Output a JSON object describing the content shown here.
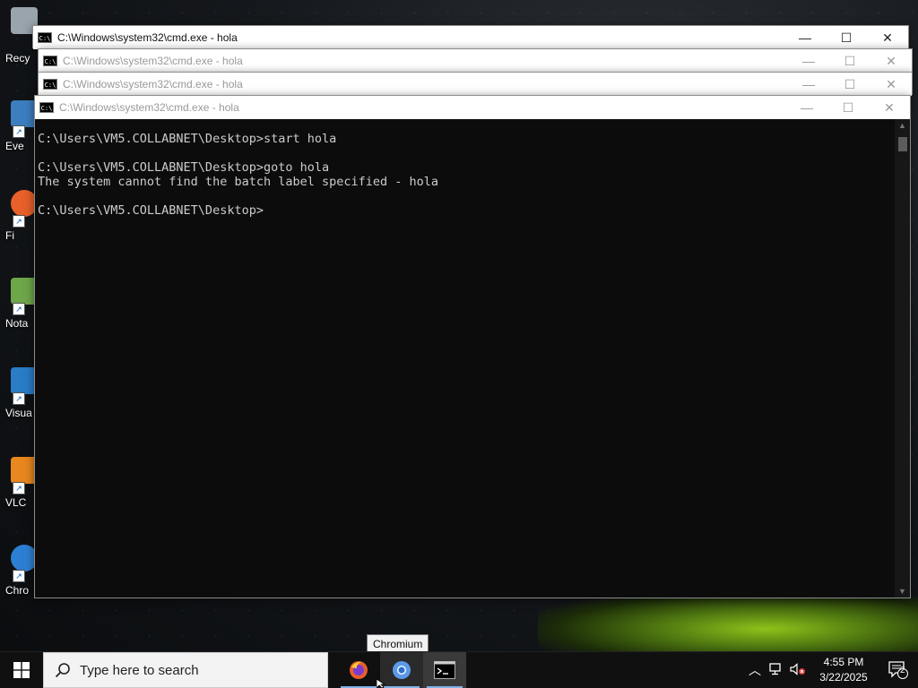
{
  "desktop": {
    "icons": [
      {
        "label": "Recy",
        "color": "#9aa4ad"
      },
      {
        "label": "Eve",
        "color": "#3c7ebf"
      },
      {
        "label": "Fi",
        "color": "#e8602a"
      },
      {
        "label": "Nota",
        "color": "#6ea64a"
      },
      {
        "label": "Visua",
        "color": "#2a7cc7"
      },
      {
        "label": "VLC",
        "color": "#e8871e"
      },
      {
        "label": "Chro",
        "color": "#2d7fd4"
      }
    ]
  },
  "windows": [
    {
      "title": "C:\\Windows\\system32\\cmd.exe - hola"
    },
    {
      "title": "C:\\Windows\\system32\\cmd.exe - hola"
    },
    {
      "title": "C:\\Windows\\system32\\cmd.exe - hola"
    },
    {
      "title": "C:\\Windows\\system32\\cmd.exe - hola"
    }
  ],
  "console": {
    "lines": "C:\\Users\\VM5.COLLABNET\\Desktop>start hola\n\nC:\\Users\\VM5.COLLABNET\\Desktop>goto hola\nThe system cannot find the batch label specified - hola\n\nC:\\Users\\VM5.COLLABNET\\Desktop>"
  },
  "window_controls": {
    "minimize": "—",
    "maximize": "☐",
    "close": "✕"
  },
  "taskbar": {
    "search_placeholder": "Type here to search",
    "tooltip": "Chromium",
    "clock_time": "4:55 PM",
    "clock_date": "3/22/2025",
    "notification_count": "2"
  }
}
